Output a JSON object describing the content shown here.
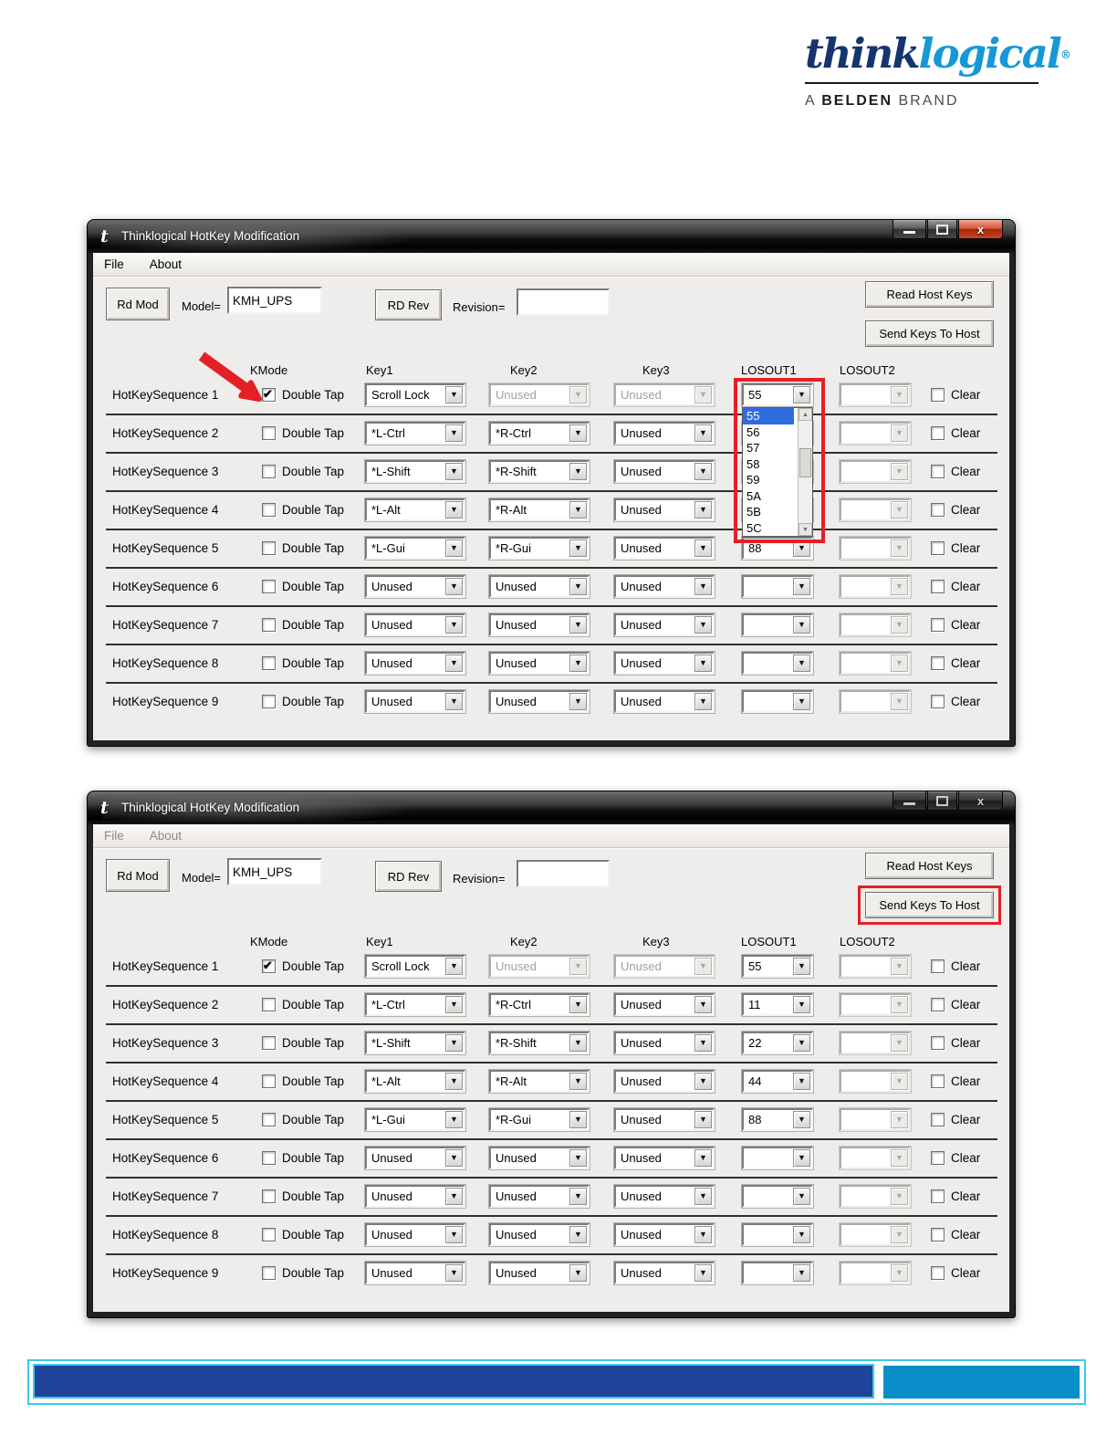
{
  "colors": {
    "accent_red": "#e32025",
    "dropdown_selection_blue": "#2e6ce0",
    "logo_dark_blue": "#16356e",
    "logo_light_blue": "#1798d6",
    "footer_dark_blue": "#1e4499",
    "footer_light_blue": "#0a8ec9",
    "footer_border_cyan": "#3fc6ec"
  },
  "logo": {
    "think": "think",
    "logical": "logical",
    "registered": "®",
    "tagline_a": "A",
    "tagline_belden": "BELDEN",
    "tagline_brand": "BRAND"
  },
  "windows": [
    {
      "title": "Thinklogical HotKey Modification",
      "active": true,
      "menu": [
        "File",
        "About"
      ],
      "toolbar": {
        "rd_mod_label": "Rd Mod",
        "model_label": "Model=",
        "model_value": "KMH_UPS",
        "rd_rev_label": "RD Rev",
        "revision_label": "Revision=",
        "revision_value": "",
        "read_host_keys_label": "Read Host Keys",
        "send_keys_label": "Send Keys To Host"
      },
      "column_headers": {
        "kmode": "KMode",
        "key1": "Key1",
        "key2": "Key2",
        "key3": "Key3",
        "losout1": "LOSOUT1",
        "losout2": "LOSOUT2"
      },
      "double_tap_label": "Double Tap",
      "clear_label": "Clear",
      "rows": [
        {
          "label": "HotKeySequence 1",
          "kmode_checked": true,
          "key1": "Scroll Lock",
          "key1_enabled": true,
          "key2": "Unused",
          "key2_enabled": false,
          "key3": "Unused",
          "key3_enabled": false,
          "losout1": "55",
          "losout2": "",
          "clear_checked": false
        },
        {
          "label": "HotKeySequence 2",
          "kmode_checked": false,
          "key1": "*L-Ctrl",
          "key1_enabled": true,
          "key2": "*R-Ctrl",
          "key2_enabled": true,
          "key3": "Unused",
          "key3_enabled": true,
          "losout1": "",
          "losout2": "",
          "clear_checked": false
        },
        {
          "label": "HotKeySequence 3",
          "kmode_checked": false,
          "key1": "*L-Shift",
          "key1_enabled": true,
          "key2": "*R-Shift",
          "key2_enabled": true,
          "key3": "Unused",
          "key3_enabled": true,
          "losout1": "",
          "losout2": "",
          "clear_checked": false
        },
        {
          "label": "HotKeySequence 4",
          "kmode_checked": false,
          "key1": "*L-Alt",
          "key1_enabled": true,
          "key2": "*R-Alt",
          "key2_enabled": true,
          "key3": "Unused",
          "key3_enabled": true,
          "losout1": "",
          "losout2": "",
          "clear_checked": false
        },
        {
          "label": "HotKeySequence 5",
          "kmode_checked": false,
          "key1": "*L-Gui",
          "key1_enabled": true,
          "key2": "*R-Gui",
          "key2_enabled": true,
          "key3": "Unused",
          "key3_enabled": true,
          "losout1": "88",
          "losout2": "",
          "clear_checked": false
        },
        {
          "label": "HotKeySequence 6",
          "kmode_checked": false,
          "key1": "Unused",
          "key1_enabled": true,
          "key2": "Unused",
          "key2_enabled": true,
          "key3": "Unused",
          "key3_enabled": true,
          "losout1": "",
          "losout2": "",
          "clear_checked": false
        },
        {
          "label": "HotKeySequence 7",
          "kmode_checked": false,
          "key1": "Unused",
          "key1_enabled": true,
          "key2": "Unused",
          "key2_enabled": true,
          "key3": "Unused",
          "key3_enabled": true,
          "losout1": "",
          "losout2": "",
          "clear_checked": false
        },
        {
          "label": "HotKeySequence 8",
          "kmode_checked": false,
          "key1": "Unused",
          "key1_enabled": true,
          "key2": "Unused",
          "key2_enabled": true,
          "key3": "Unused",
          "key3_enabled": true,
          "losout1": "",
          "losout2": "",
          "clear_checked": false
        },
        {
          "label": "HotKeySequence 9",
          "kmode_checked": false,
          "key1": "Unused",
          "key1_enabled": true,
          "key2": "Unused",
          "key2_enabled": true,
          "key3": "Unused",
          "key3_enabled": true,
          "losout1": "",
          "losout2": "",
          "clear_checked": false
        }
      ],
      "open_dropdown": {
        "column": "LOSOUT1",
        "for_row": "HotKeySequence 1",
        "items": [
          "55",
          "56",
          "57",
          "58",
          "59",
          "5A",
          "5B",
          "5C"
        ],
        "selected": "55"
      },
      "annotations": {
        "red_arrow_to_kmode_row1": true,
        "red_box_losout1_dropdown": true,
        "red_box_send_keys_button": false
      }
    },
    {
      "title": "Thinklogical HotKey Modification",
      "active": false,
      "menu": [
        "File",
        "About"
      ],
      "toolbar": {
        "rd_mod_label": "Rd Mod",
        "model_label": "Model=",
        "model_value": "KMH_UPS",
        "rd_rev_label": "RD Rev",
        "revision_label": "Revision=",
        "revision_value": "",
        "read_host_keys_label": "Read Host Keys",
        "send_keys_label": "Send Keys To Host"
      },
      "column_headers": {
        "kmode": "KMode",
        "key1": "Key1",
        "key2": "Key2",
        "key3": "Key3",
        "losout1": "LOSOUT1",
        "losout2": "LOSOUT2"
      },
      "double_tap_label": "Double Tap",
      "clear_label": "Clear",
      "rows": [
        {
          "label": "HotKeySequence 1",
          "kmode_checked": true,
          "key1": "Scroll Lock",
          "key1_enabled": true,
          "key2": "Unused",
          "key2_enabled": false,
          "key3": "Unused",
          "key3_enabled": false,
          "losout1": "55",
          "losout2": "",
          "clear_checked": false
        },
        {
          "label": "HotKeySequence 2",
          "kmode_checked": false,
          "key1": "*L-Ctrl",
          "key1_enabled": true,
          "key2": "*R-Ctrl",
          "key2_enabled": true,
          "key3": "Unused",
          "key3_enabled": true,
          "losout1": "11",
          "losout2": "",
          "clear_checked": false
        },
        {
          "label": "HotKeySequence 3",
          "kmode_checked": false,
          "key1": "*L-Shift",
          "key1_enabled": true,
          "key2": "*R-Shift",
          "key2_enabled": true,
          "key3": "Unused",
          "key3_enabled": true,
          "losout1": "22",
          "losout2": "",
          "clear_checked": false
        },
        {
          "label": "HotKeySequence 4",
          "kmode_checked": false,
          "key1": "*L-Alt",
          "key1_enabled": true,
          "key2": "*R-Alt",
          "key2_enabled": true,
          "key3": "Unused",
          "key3_enabled": true,
          "losout1": "44",
          "losout2": "",
          "clear_checked": false
        },
        {
          "label": "HotKeySequence 5",
          "kmode_checked": false,
          "key1": "*L-Gui",
          "key1_enabled": true,
          "key2": "*R-Gui",
          "key2_enabled": true,
          "key3": "Unused",
          "key3_enabled": true,
          "losout1": "88",
          "losout2": "",
          "clear_checked": false
        },
        {
          "label": "HotKeySequence 6",
          "kmode_checked": false,
          "key1": "Unused",
          "key1_enabled": true,
          "key2": "Unused",
          "key2_enabled": true,
          "key3": "Unused",
          "key3_enabled": true,
          "losout1": "",
          "losout2": "",
          "clear_checked": false
        },
        {
          "label": "HotKeySequence 7",
          "kmode_checked": false,
          "key1": "Unused",
          "key1_enabled": true,
          "key2": "Unused",
          "key2_enabled": true,
          "key3": "Unused",
          "key3_enabled": true,
          "losout1": "",
          "losout2": "",
          "clear_checked": false
        },
        {
          "label": "HotKeySequence 8",
          "kmode_checked": false,
          "key1": "Unused",
          "key1_enabled": true,
          "key2": "Unused",
          "key2_enabled": true,
          "key3": "Unused",
          "key3_enabled": true,
          "losout1": "",
          "losout2": "",
          "clear_checked": false
        },
        {
          "label": "HotKeySequence 9",
          "kmode_checked": false,
          "key1": "Unused",
          "key1_enabled": true,
          "key2": "Unused",
          "key2_enabled": true,
          "key3": "Unused",
          "key3_enabled": true,
          "losout1": "",
          "losout2": "",
          "clear_checked": false
        }
      ],
      "annotations": {
        "red_arrow_to_kmode_row1": false,
        "red_box_losout1_dropdown": false,
        "red_box_send_keys_button": true
      }
    }
  ]
}
